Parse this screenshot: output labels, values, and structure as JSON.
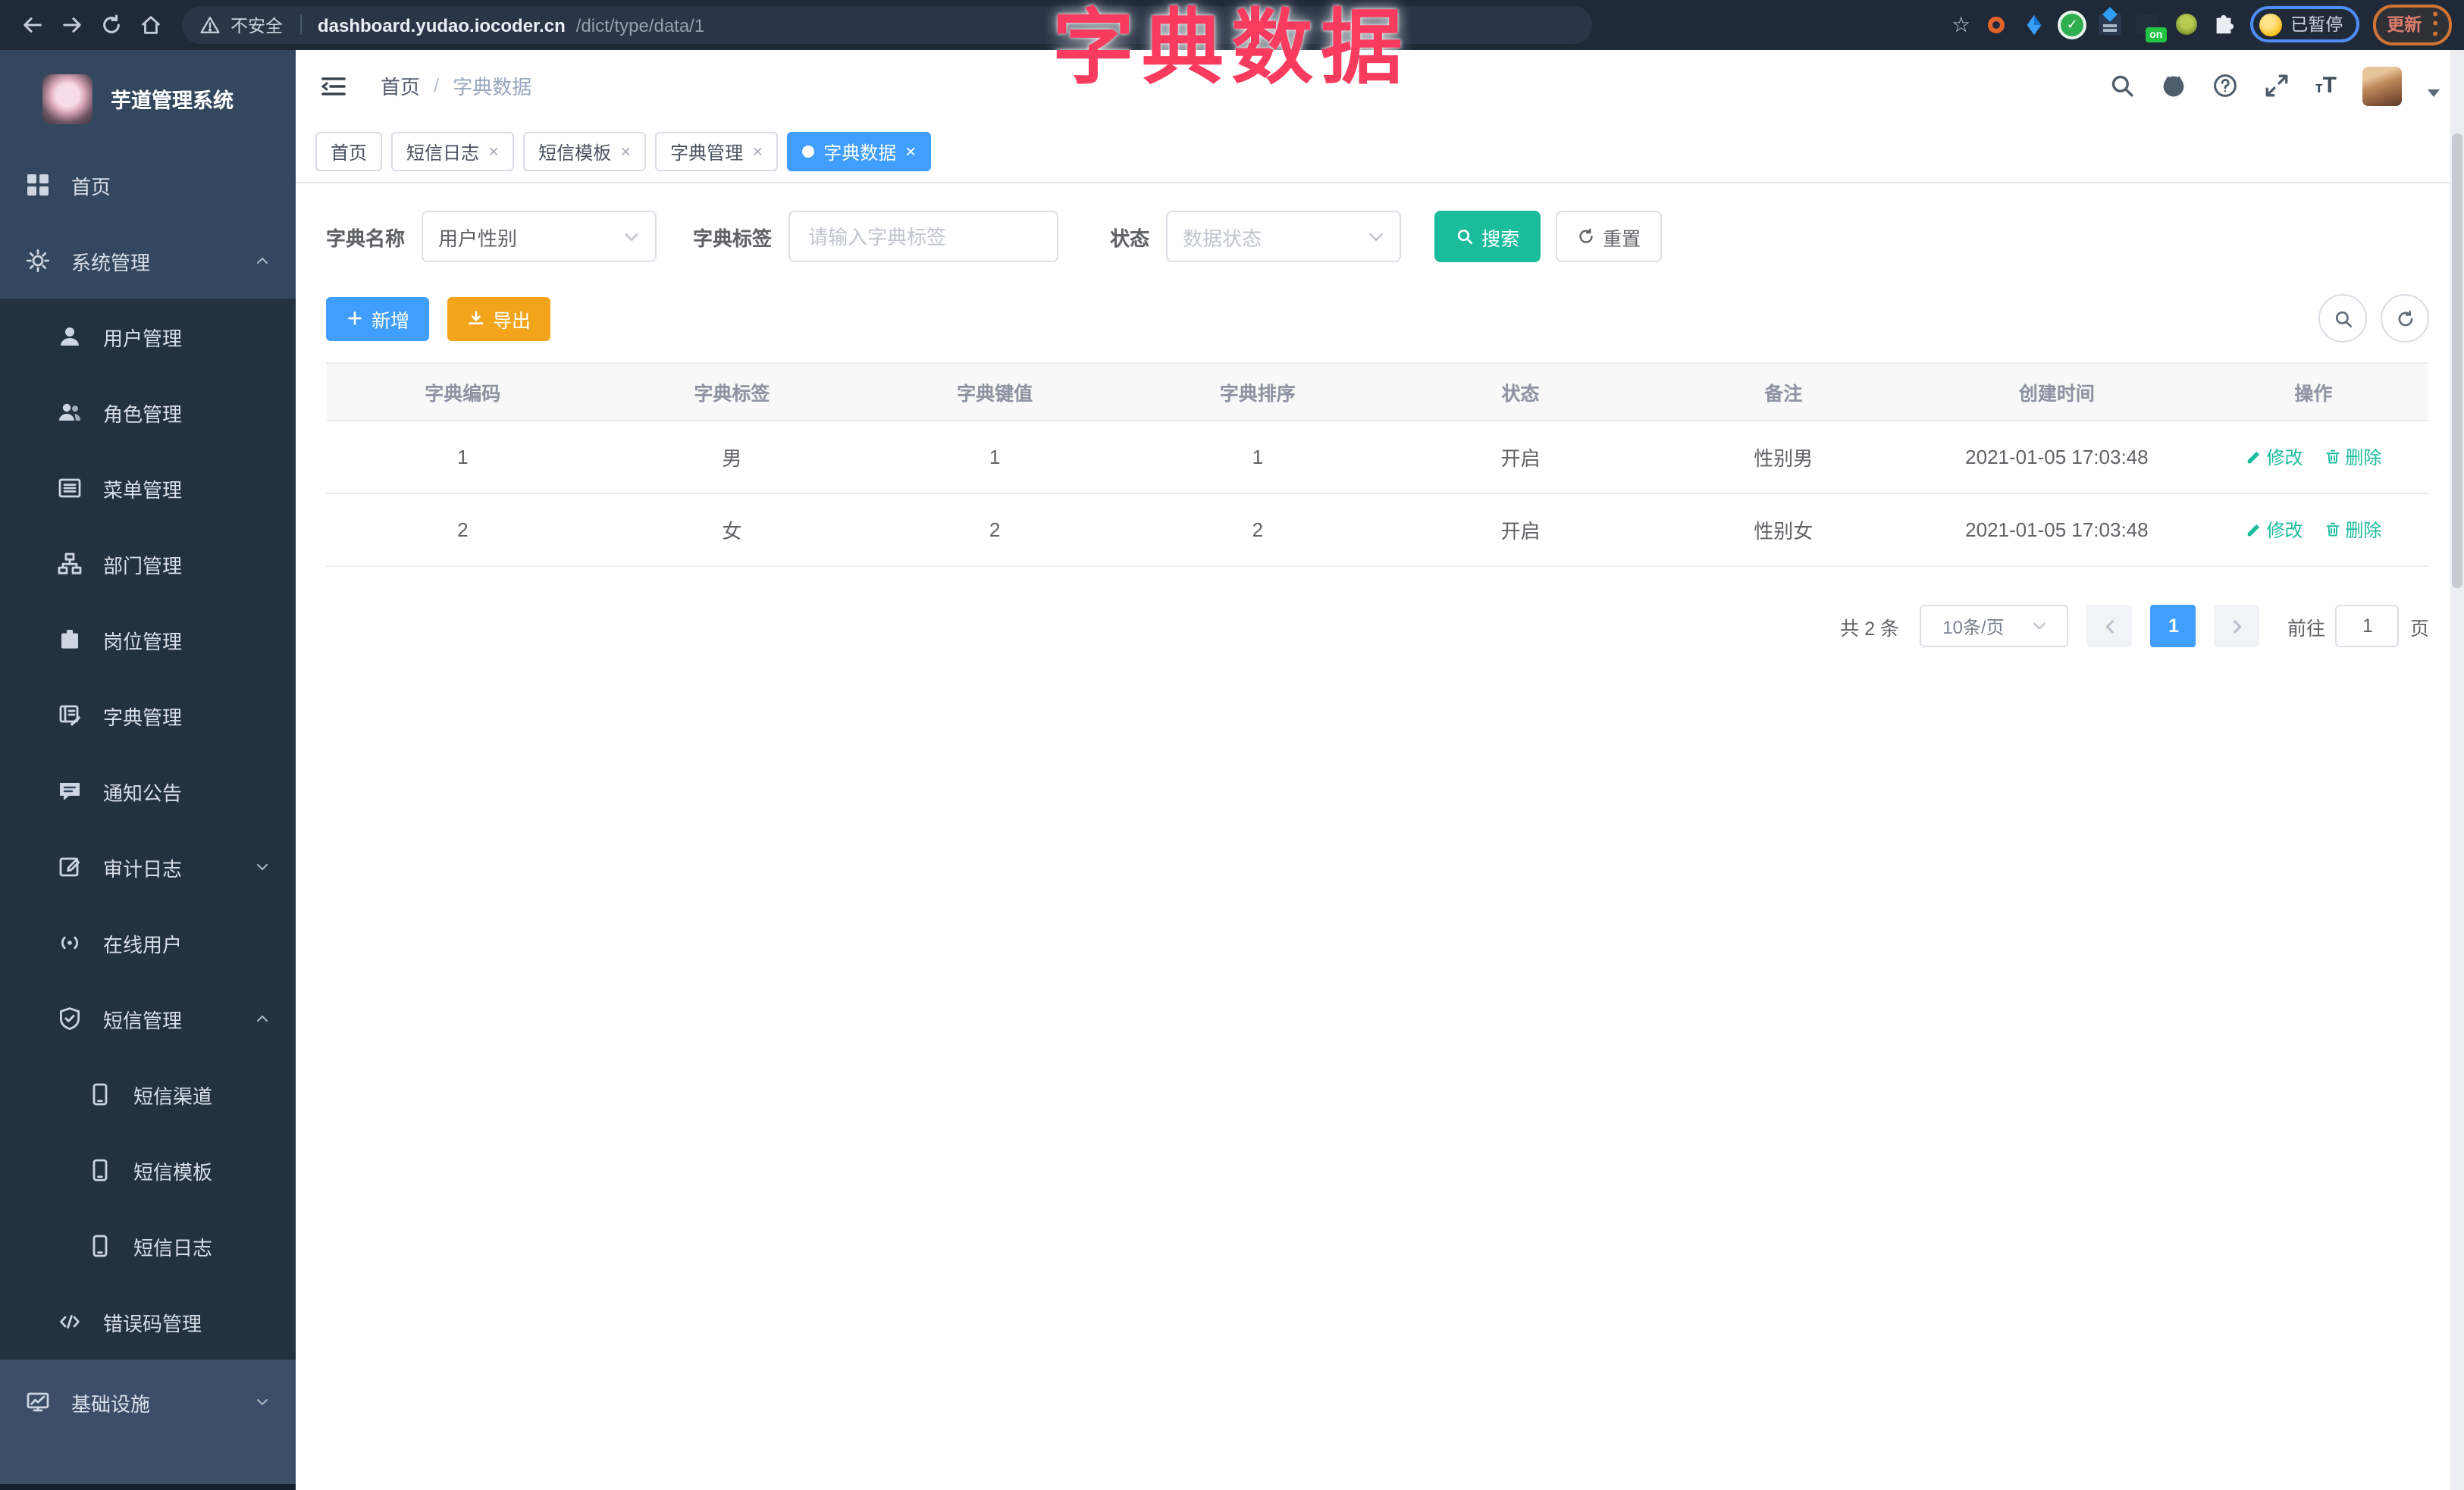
{
  "browser": {
    "security_label": "不安全",
    "url_host": "dashboard.yudao.iocoder.cn",
    "url_path": "/dict/type/data/1",
    "on_badge": "on",
    "paused_badge": "已暂停",
    "update_button": "更新"
  },
  "overlay_title": "字典数据",
  "sidebar": {
    "title": "芋道管理系统",
    "items": [
      {
        "label": "首页",
        "icon": "dashboard-icon",
        "level": 1
      },
      {
        "label": "系统管理",
        "icon": "gear-icon",
        "level": 1,
        "arrow": "up"
      },
      {
        "label": "用户管理",
        "icon": "user-icon",
        "level": 2
      },
      {
        "label": "角色管理",
        "icon": "users-icon",
        "level": 2
      },
      {
        "label": "菜单管理",
        "icon": "menu-list-icon",
        "level": 2
      },
      {
        "label": "部门管理",
        "icon": "org-tree-icon",
        "level": 2
      },
      {
        "label": "岗位管理",
        "icon": "badge-icon",
        "level": 2
      },
      {
        "label": "字典管理",
        "icon": "book-icon",
        "level": 2
      },
      {
        "label": "通知公告",
        "icon": "bubble-icon",
        "level": 2
      },
      {
        "label": "审计日志",
        "icon": "log-icon",
        "level": 2,
        "arrow": "down"
      },
      {
        "label": "在线用户",
        "icon": "online-icon",
        "level": 2
      },
      {
        "label": "短信管理",
        "icon": "shield-icon",
        "level": 2,
        "arrow": "up"
      },
      {
        "label": "短信渠道",
        "icon": "phone-icon",
        "level": 3
      },
      {
        "label": "短信模板",
        "icon": "phone-icon",
        "level": 3
      },
      {
        "label": "短信日志",
        "icon": "phone-icon",
        "level": 3
      },
      {
        "label": "错误码管理",
        "icon": "code-icon",
        "level": 2
      },
      {
        "label": "基础设施",
        "icon": "monitor-icon",
        "level": 1,
        "arrow": "down",
        "section": "bottom"
      }
    ]
  },
  "header": {
    "breadcrumb": [
      "首页",
      "字典数据"
    ],
    "breadcrumb_separator": "/"
  },
  "tabs": [
    {
      "label": "首页",
      "closable": false,
      "active": false
    },
    {
      "label": "短信日志",
      "closable": true,
      "active": false
    },
    {
      "label": "短信模板",
      "closable": true,
      "active": false
    },
    {
      "label": "字典管理",
      "closable": true,
      "active": false
    },
    {
      "label": "字典数据",
      "closable": true,
      "active": true
    }
  ],
  "filters": {
    "name_label": "字典名称",
    "name_value": "用户性别",
    "tag_label": "字典标签",
    "tag_placeholder": "请输入字典标签",
    "status_label": "状态",
    "status_placeholder": "数据状态",
    "search_label": "搜索",
    "reset_label": "重置"
  },
  "toolbar": {
    "add_label": "新增",
    "export_label": "导出"
  },
  "table": {
    "headers": [
      "字典编码",
      "字典标签",
      "字典键值",
      "字典排序",
      "状态",
      "备注",
      "创建时间",
      "操作"
    ],
    "rows": [
      {
        "code": "1",
        "label": "男",
        "value": "1",
        "sort": "1",
        "status": "开启",
        "remark": "性别男",
        "created": "2021-01-05 17:03:48"
      },
      {
        "code": "2",
        "label": "女",
        "value": "2",
        "sort": "2",
        "status": "开启",
        "remark": "性别女",
        "created": "2021-01-05 17:03:48"
      }
    ],
    "actions": {
      "edit": "修改",
      "delete": "删除"
    }
  },
  "pagination": {
    "total_text": "共 2 条",
    "page_size": "10条/页",
    "current_page": "1",
    "goto_label": "前往",
    "goto_value": "1",
    "page_suffix": "页"
  },
  "colors": {
    "accent_blue": "#409eff",
    "theme_teal": "#1abc9c",
    "export_orange": "#f2a51a",
    "title_pink": "#f83b5e",
    "sidebar_bg": "#33475e",
    "submenu_bg": "#24323f"
  }
}
